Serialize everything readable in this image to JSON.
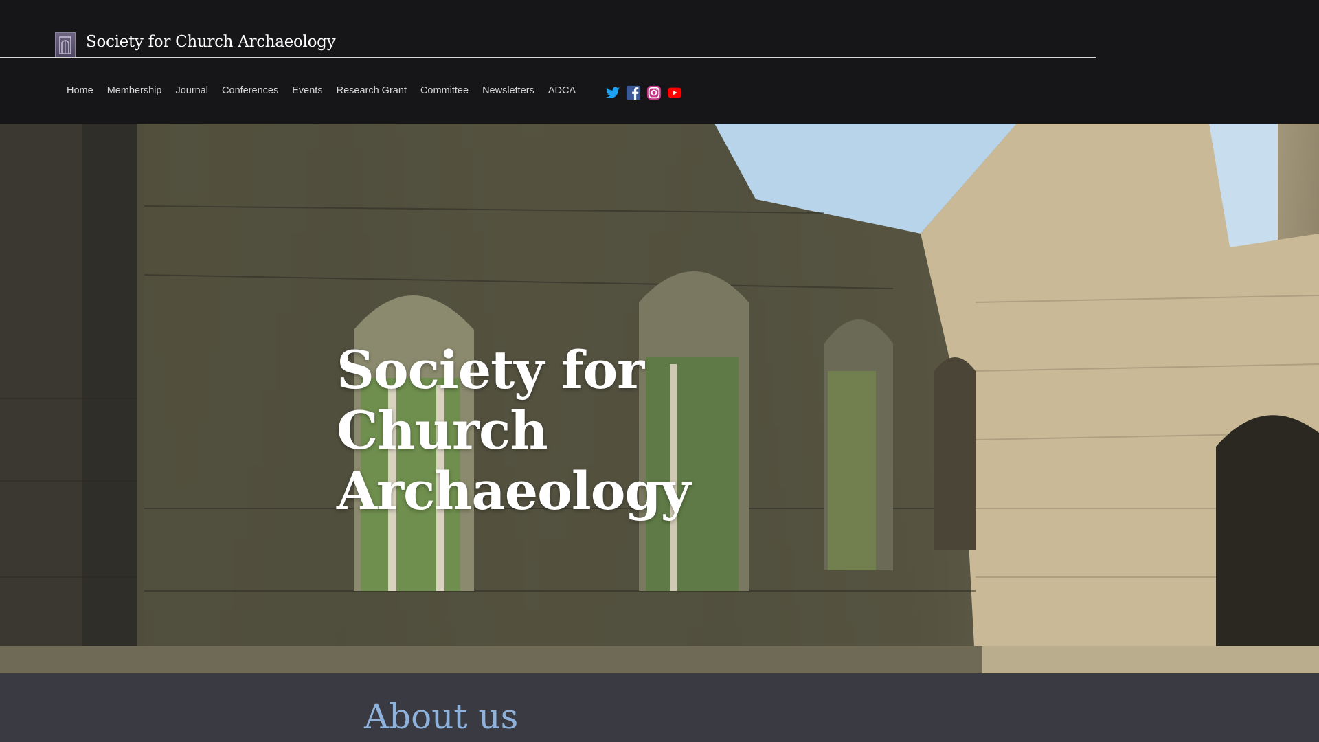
{
  "header": {
    "site_title": "Society for Church Archaeology",
    "logo_icon": "church-window-logo-icon"
  },
  "nav": {
    "items": [
      {
        "label": "Home"
      },
      {
        "label": "Membership"
      },
      {
        "label": "Journal"
      },
      {
        "label": "Conferences"
      },
      {
        "label": "Events"
      },
      {
        "label": "Research Grant"
      },
      {
        "label": "Committee"
      },
      {
        "label": "Newsletters"
      },
      {
        "label": "ADCA"
      }
    ]
  },
  "social": {
    "twitter_icon": "twitter-icon",
    "facebook_icon": "facebook-icon",
    "instagram_icon": "instagram-icon",
    "youtube_icon": "youtube-icon",
    "colors": {
      "twitter": "#1da1f2",
      "facebook": "#3b5998",
      "instagram": "#c13584",
      "youtube": "#ff0000"
    }
  },
  "hero": {
    "title": "Society for Church Archaeology",
    "image_alt": "ruined church stone arches"
  },
  "about": {
    "heading": "About us"
  },
  "colors": {
    "background": "#161618",
    "about_bg": "#3a3a42",
    "about_heading": "#8fb2dd"
  }
}
